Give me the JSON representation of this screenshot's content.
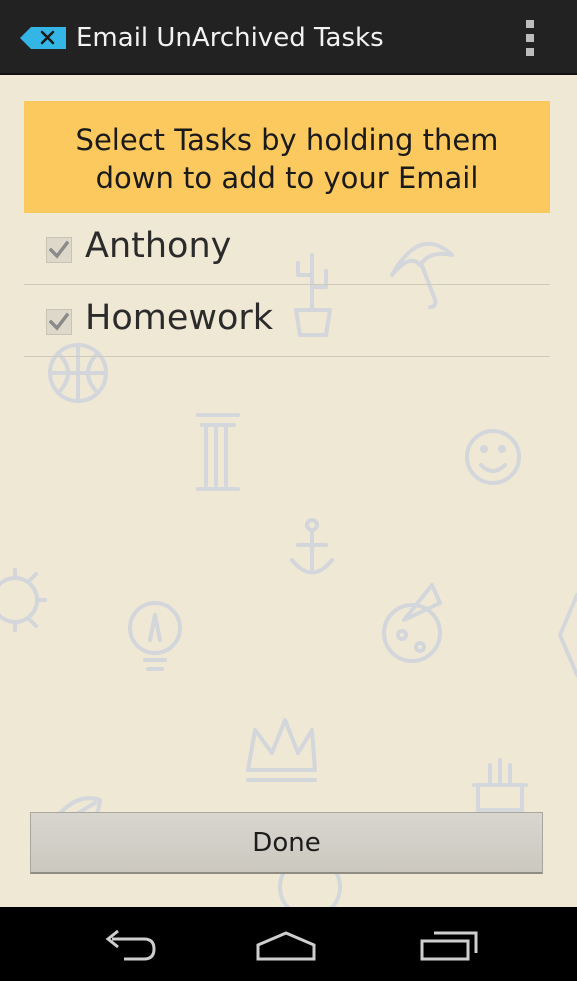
{
  "action_bar": {
    "title": "Email UnArchived Tasks",
    "app_icon": "clear-x-icon",
    "menu_icon": "overflow-menu-icon"
  },
  "banner": {
    "line1": "Select Tasks by holding them",
    "line2": "down to add to your Email"
  },
  "tasks": [
    {
      "label": "Anthony",
      "checked": true
    },
    {
      "label": "Homework",
      "checked": true
    }
  ],
  "done_button": {
    "label": "Done"
  },
  "nav_bar": {
    "back_icon": "back-icon",
    "home_icon": "home-icon",
    "recents_icon": "recent-apps-icon"
  },
  "colors": {
    "action_bar": "#222222",
    "accent_blue": "#33b5e5",
    "banner": "#fcc95e",
    "background": "#eee8d5"
  }
}
